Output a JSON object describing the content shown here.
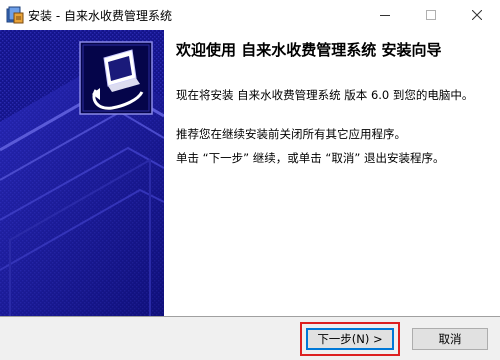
{
  "window": {
    "title": "安装 - 自来水收费管理系统",
    "controls": {
      "minimize_icon": "minimize-icon",
      "maximize_icon": "maximize-icon",
      "close_icon": "close-icon"
    }
  },
  "content": {
    "welcome_title": "欢迎使用 自来水收费管理系统 安装向导",
    "install_text": "现在将安装 自来水收费管理系统 版本 6.0 到您的电脑中。",
    "recommend_text": "推荐您在继续安装前关闭所有其它应用程序。",
    "instruction_text": "单击 “下一步” 继续，或单击 “取消” 退出安装程序。"
  },
  "buttons": {
    "next_label": "下一步(N) >",
    "cancel_label": "取消"
  },
  "colors": {
    "banner_background": "#14148c",
    "highlight_border": "#dd2020",
    "focus_border": "#0078d7"
  }
}
